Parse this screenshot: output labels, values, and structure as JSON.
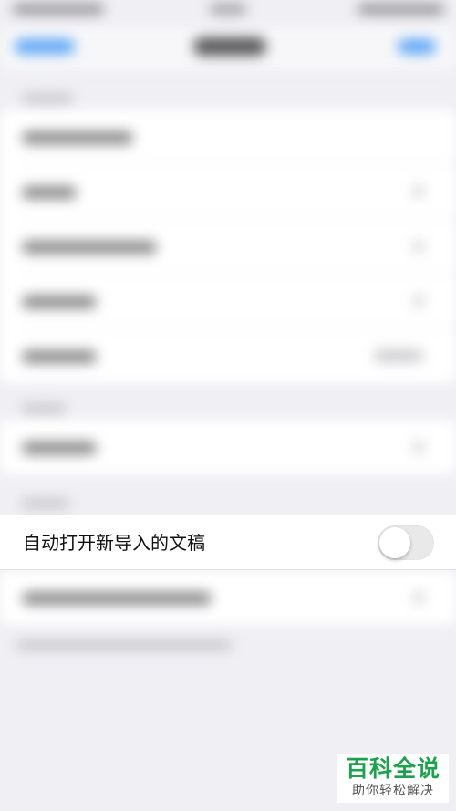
{
  "focused_setting": {
    "label": "自动打开新导入的文稿",
    "toggle_on": false
  },
  "watermark": {
    "title": "百科全说",
    "subtitle": "助你轻松解决"
  },
  "colors": {
    "background": "#efeff4",
    "toggle_off": "#e9e9ea",
    "link_blue": "#2f8ff5",
    "watermark_green": "#1aa34a"
  }
}
